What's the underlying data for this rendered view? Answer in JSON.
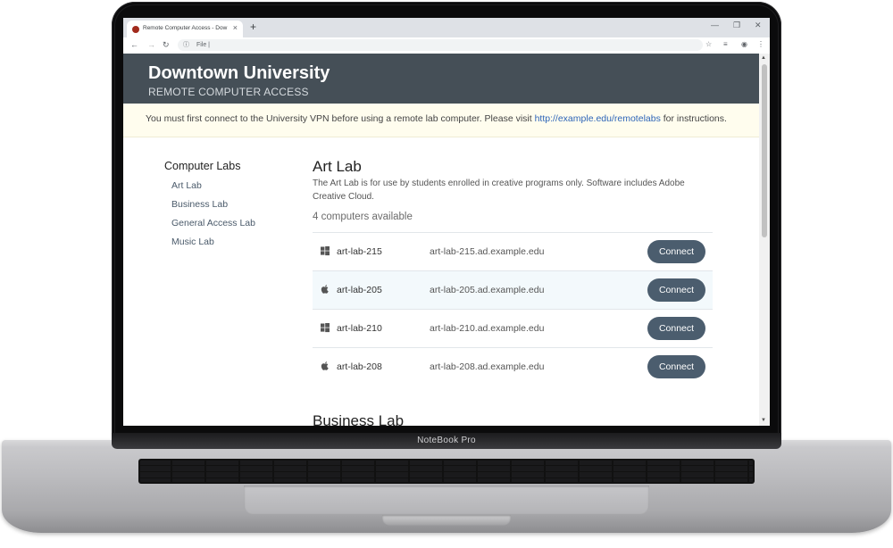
{
  "laptop": {
    "brand": "NoteBook Pro"
  },
  "browser": {
    "tab_title": "Remote Computer Access - Dow",
    "address": "File |",
    "new_tab_glyph": "+",
    "colors": {
      "favicon": "#a12a1c",
      "tabbar": "#dee1e6"
    }
  },
  "site": {
    "title": "Downtown University",
    "subtitle": "REMOTE COMPUTER ACCESS",
    "header_color": "#454f57",
    "notice": {
      "before": "You must first connect to the University VPN before using a remote lab computer. Please visit ",
      "link": "http://example.edu/remotelabs",
      "after": " for instructions."
    }
  },
  "sidebar": {
    "heading": "Computer Labs",
    "items": [
      {
        "label": "Art Lab"
      },
      {
        "label": "Business Lab"
      },
      {
        "label": "General Access Lab"
      },
      {
        "label": "Music Lab"
      }
    ]
  },
  "labs": [
    {
      "title": "Art Lab",
      "description": "The Art Lab is for use by students enrolled in creative programs only. Software includes Adobe Creative Cloud.",
      "availability": "4 computers available",
      "computers": [
        {
          "os_icon": "windows-icon",
          "name": "art-lab-215",
          "host": "art-lab-215.ad.example.edu",
          "action": "Connect"
        },
        {
          "os_icon": "apple-icon",
          "name": "art-lab-205",
          "host": "art-lab-205.ad.example.edu",
          "action": "Connect"
        },
        {
          "os_icon": "windows-icon",
          "name": "art-lab-210",
          "host": "art-lab-210.ad.example.edu",
          "action": "Connect"
        },
        {
          "os_icon": "apple-icon",
          "name": "art-lab-208",
          "host": "art-lab-208.ad.example.edu",
          "action": "Connect"
        }
      ]
    },
    {
      "title": "Business Lab"
    }
  ],
  "colors": {
    "connect_button": "#4b5d6e",
    "link": "#2e65b8",
    "notice_bg": "#fffdee"
  }
}
